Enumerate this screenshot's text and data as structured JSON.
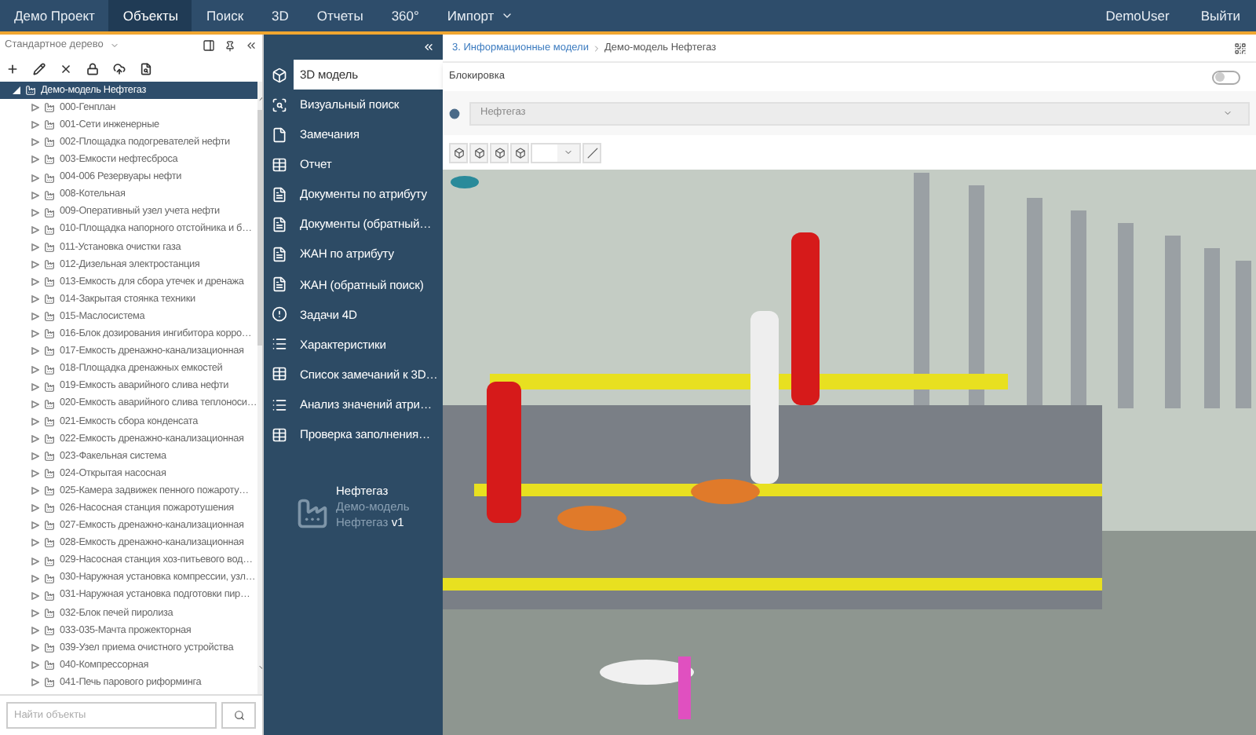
{
  "nav": {
    "items": [
      {
        "label": "Демо Проект",
        "selected": false,
        "kind": "link"
      },
      {
        "label": "Объекты",
        "selected": true,
        "kind": "link"
      },
      {
        "label": "Поиск",
        "selected": false,
        "kind": "link"
      },
      {
        "label": "3D",
        "selected": false,
        "kind": "link"
      },
      {
        "label": "Отчеты",
        "selected": false,
        "kind": "link"
      },
      {
        "label": "360°",
        "selected": false,
        "kind": "link"
      },
      {
        "label": "Импорт",
        "selected": false,
        "kind": "dropdown"
      }
    ],
    "user": "DemoUser",
    "logout": "Выйти"
  },
  "tree_panel": {
    "title": "Стандартное дерево",
    "tree": [
      {
        "label": "Демо-модель Нефтегаз",
        "selected": true,
        "expanded": true,
        "children": [
          {
            "label": "000-Генплан",
            "expanded": false
          },
          {
            "label": "001-Сети инженерные",
            "expanded": false
          },
          {
            "label": "002-Площадка подогревателей нефти",
            "expanded": false
          },
          {
            "label": "003-Емкости нефтесброса",
            "expanded": false
          },
          {
            "label": "004-006 Резервуары нефти",
            "expanded": false
          },
          {
            "label": "008-Котельная",
            "expanded": false
          },
          {
            "label": "009-Оперативный узел учета нефти",
            "expanded": false
          },
          {
            "label": "010-Площадка напорного отстойника и б…",
            "expanded": false
          },
          {
            "label": "011-Установка очистки газа",
            "expanded": false
          },
          {
            "label": "012-Дизельная электростанция",
            "expanded": false
          },
          {
            "label": "013-Емкость для сбора утечек и дренажа",
            "expanded": false
          },
          {
            "label": "014-Закрытая стоянка техники",
            "expanded": false
          },
          {
            "label": "015-Маслосистема",
            "expanded": false
          },
          {
            "label": "016-Блок дозирования ингибитора корро…",
            "expanded": false
          },
          {
            "label": "017-Емкость дренажно-канализационная",
            "expanded": false
          },
          {
            "label": "018-Площадка дренажных емкостей",
            "expanded": false
          },
          {
            "label": "019-Емкость аварийного слива нефти",
            "expanded": false
          },
          {
            "label": "020-Емкость аварийного слива теплоноси…",
            "expanded": false
          },
          {
            "label": "021-Емкость сбора конденсата",
            "expanded": false
          },
          {
            "label": "022-Емкость дренажно-канализационная",
            "expanded": false
          },
          {
            "label": "023-Факельная система",
            "expanded": false
          },
          {
            "label": "024-Открытая насосная",
            "expanded": false
          },
          {
            "label": "025-Камера задвижек пенного пожароту…",
            "expanded": false
          },
          {
            "label": "026-Насосная станция пожаротушения",
            "expanded": false
          },
          {
            "label": "027-Емкость дренажно-канализационная",
            "expanded": false
          },
          {
            "label": "028-Емкость дренажно-канализационная",
            "expanded": false
          },
          {
            "label": "029-Насосная станция хоз-питьевого вод…",
            "expanded": false
          },
          {
            "label": "030-Наружная установка компрессии, узл…",
            "expanded": false
          },
          {
            "label": "031-Наружная установка подготовки пир…",
            "expanded": false
          },
          {
            "label": "032-Блок печей пиролиза",
            "expanded": false
          },
          {
            "label": "033-035-Мачта прожекторная",
            "expanded": false
          },
          {
            "label": "039-Узел приема очистного устройства",
            "expanded": false
          },
          {
            "label": "040-Компрессорная",
            "expanded": false
          },
          {
            "label": "041-Печь парового риформинга",
            "expanded": false
          }
        ]
      }
    ],
    "search": {
      "placeholder": "Найти объекты"
    }
  },
  "menu": {
    "items": [
      {
        "label": "3D модель",
        "selected": true,
        "kind": "cube"
      },
      {
        "label": "Визуальный поиск",
        "selected": false,
        "kind": "search"
      },
      {
        "label": "Замечания",
        "selected": false,
        "kind": "page"
      },
      {
        "label": "Отчет",
        "selected": false,
        "kind": "table"
      },
      {
        "label": "Документы по атрибуту",
        "selected": false,
        "kind": "doc"
      },
      {
        "label": "Документы (обратный…",
        "selected": false,
        "kind": "doc"
      },
      {
        "label": "ЖАН по атрибуту",
        "selected": false,
        "kind": "file"
      },
      {
        "label": "ЖАН (обратный поиск)",
        "selected": false,
        "kind": "file"
      },
      {
        "label": "Задачи 4D",
        "selected": false,
        "kind": "alert"
      },
      {
        "label": "Характеристики",
        "selected": false,
        "kind": "list"
      },
      {
        "label": "Список замечаний к 3D…",
        "selected": false,
        "kind": "table"
      },
      {
        "label": "Анализ значений атри…",
        "selected": false,
        "kind": "list"
      },
      {
        "label": "Проверка заполнения…",
        "selected": false,
        "kind": "table"
      }
    ],
    "project": {
      "name": "Нефтегаз",
      "model": "Демо-модель Нефтегаз",
      "version": "v1"
    }
  },
  "main": {
    "breadcrumb": [
      {
        "label": "3. Информационные модели",
        "kind": "link"
      },
      {
        "label": "Демо-модель Нефтегаз",
        "kind": "current"
      }
    ],
    "lock": {
      "label": "Блокировка",
      "on": false
    },
    "model_select": {
      "value": "Нефтегаз"
    }
  }
}
